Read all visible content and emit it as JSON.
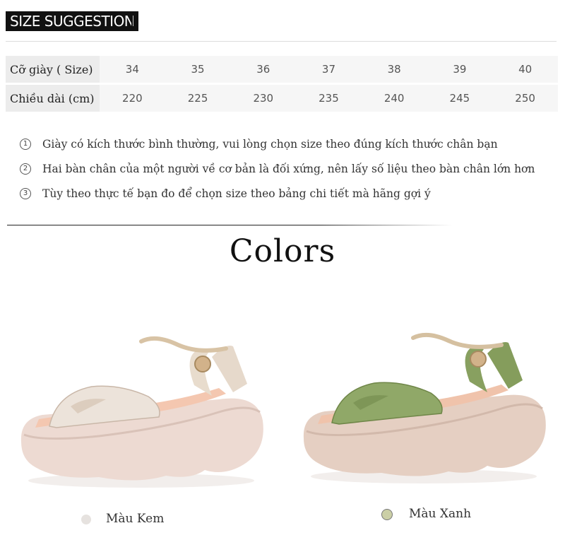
{
  "header": {
    "title": "SIZE SUGGESTION"
  },
  "size_table": {
    "rows": [
      {
        "label": "Cỡ giày ( Size)",
        "cells": [
          "34",
          "35",
          "36",
          "37",
          "38",
          "39",
          "40"
        ]
      },
      {
        "label": "Chiều dài (cm)",
        "cells": [
          "220",
          "225",
          "230",
          "235",
          "240",
          "245",
          "250"
        ]
      }
    ]
  },
  "notes": [
    {
      "num": "1",
      "text": "Giày có kích thước bình thường, vui lòng chọn size theo đúng kích thước chân bạn"
    },
    {
      "num": "2",
      "text": "Hai bàn chân của một người về cơ bản là đối xứng, nên lấy số liệu theo bàn chân lớn hơn"
    },
    {
      "num": "3",
      "text": "Tùy theo thực tế bạn đo để chọn size theo bảng chi tiết mà hãng gợi ý"
    }
  ],
  "colors_section": {
    "heading": "Colors",
    "options": [
      {
        "label": "Màu Kem",
        "swatch": "#e6e2df",
        "strap": "#e9dcd0",
        "sole": "#e8d2c9"
      },
      {
        "label": "Màu Xanh",
        "swatch": "#cbcfa6",
        "strap": "#8fa565",
        "sole": "#e0c9ba"
      }
    ]
  }
}
